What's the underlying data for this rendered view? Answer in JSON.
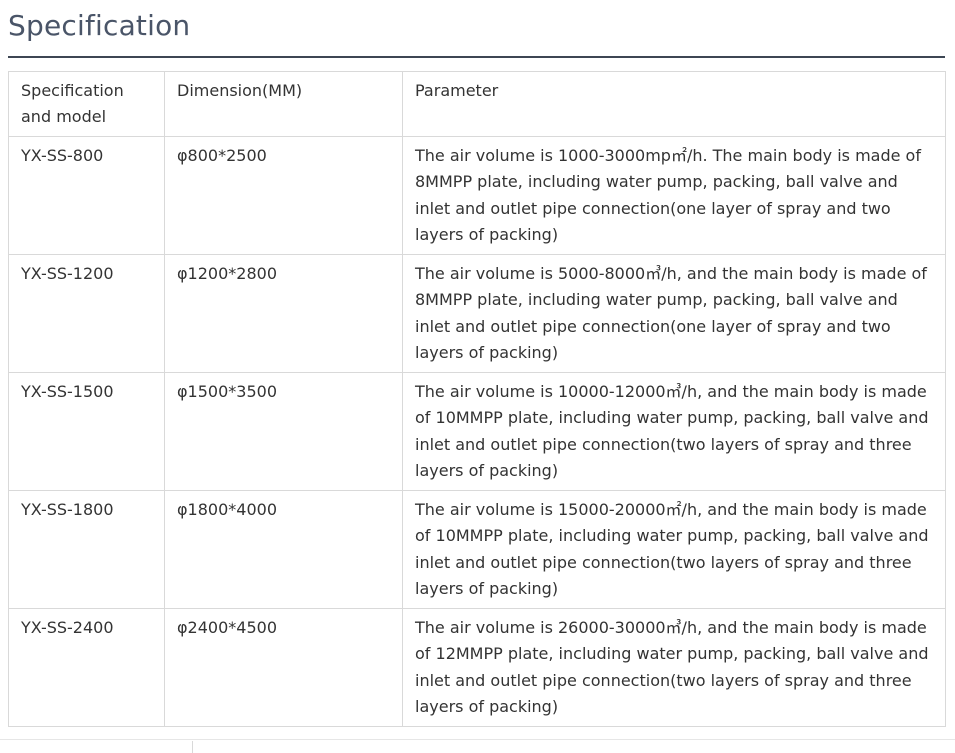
{
  "page": {
    "title": "Specification"
  },
  "table": {
    "headers": [
      "Specification and model",
      "Dimension(MM)",
      "Parameter"
    ],
    "rows": [
      {
        "model": "YX-SS-800",
        "dimension": "φ800*2500",
        "parameter": "The air volume is 1000-3000mp㎡/h. The main body is made of 8MMPP plate, including water pump, packing, ball valve and inlet and outlet pipe connection(one layer of spray and two layers of packing)"
      },
      {
        "model": "YX-SS-1200",
        "dimension": "φ1200*2800",
        "parameter": "The air volume is 5000-8000㎥/h, and the main body is made of 8MMPP plate, including water pump, packing, ball valve and inlet and outlet pipe connection(one layer of spray and two layers of packing)"
      },
      {
        "model": "YX-SS-1500",
        "dimension": "φ1500*3500",
        "parameter": "The air volume is 10000-12000㎥/h, and the main body is made of 10MMPP plate, including water pump, packing, ball valve and inlet and outlet pipe connection(two layers of spray and three layers of packing)"
      },
      {
        "model": "YX-SS-1800",
        "dimension": "φ1800*4000",
        "parameter": "The air volume is 15000-20000㎡/h, and the main body is made of 10MMPP plate, including water pump, packing, ball valve and inlet and outlet pipe connection(two layers of spray and three layers of packing)"
      },
      {
        "model": "YX-SS-2400",
        "dimension": "φ2400*4500",
        "parameter": "The air volume is 26000-30000㎥/h, and the main body is made of 12MMPP plate, including water pump, packing, ball valve and inlet and outlet pipe connection(two layers of spray and three layers of packing)"
      }
    ]
  },
  "colors": {
    "title": "#4a5568",
    "rule": "#3d4653",
    "border": "#d9d9d9",
    "text": "#333333"
  }
}
